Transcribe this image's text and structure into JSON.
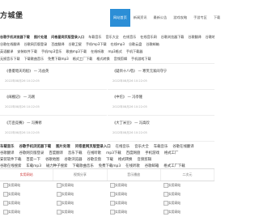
{
  "site": {
    "logo": "方城堡"
  },
  "nav": [
    "网站首页",
    "新闻资讯",
    "最新公告",
    "游戏攻略",
    "手游专区",
    "下载"
  ],
  "links_row1": [
    "谷歌手机浏览器下载",
    "图片处理",
    "问卷星网页版登录入口",
    "车载音乐",
    "音乐大全",
    "在线音乐",
    "在线音乐网",
    "谷歌浏览器下载",
    "谷歌翻译",
    "谷歌地图"
  ],
  "links_row2": [
    "谷歌在线翻译",
    "谷歌网页版登录",
    "百度翻译",
    "谷歌卫星",
    "手机mp3下载",
    "在线mp3",
    "谷歌云盘",
    "谷歌邮箱"
  ],
  "links_row3": [
    "英语翻译",
    "安装软件下载",
    "手机mp3音乐",
    "歌曲mp3下载",
    "在线听歌",
    "mp3格式",
    "手机下载器"
  ],
  "links_row4": [
    "无损音乐下载",
    "下载歌曲音乐",
    "免费下载mp3",
    "格式工厂下载",
    "格式转换",
    "音频剪辑",
    "手机游戏下载"
  ],
  "cards": [
    {
      "title": "《香菱暗天的程》 — 冯益英",
      "time": "2022年08月26 10:22:05"
    },
    {
      "title": "《疑目十八嗒》 — 寒笑元家间守宁",
      "time": "2022年08月26 10:22:05"
    },
    {
      "title": "《阔楓记》 — 冯刚",
      "time": "2022年08月26 10:22:05"
    },
    {
      "title": "《中佗》 — 冯亭隆",
      "time": "2022年08月26 10:22:05"
    },
    {
      "title": "《万亩竞赛》 — 冯赛修",
      "time": "2022年08月26 10:22:05"
    },
    {
      "title": "《大丁米豆》 — 冯高欣",
      "time": "2022年08月26 10:22:05"
    }
  ],
  "cat_row1": [
    "车载音乐",
    "谷歌手机浏览器下载",
    "图片处理",
    "问卷星网页版登录入口",
    "在线音乐",
    "音乐大全",
    "车载音乐",
    "谷歌在线翻译"
  ],
  "cat_row2": [
    "谷歌翻译",
    "谷歌网页版登录",
    "百度翻译",
    "音乐下载",
    "在线听歌",
    "mp3下载",
    "百度网盘",
    "手机游戏",
    "格式工厂"
  ],
  "cat_row3": [
    "安装软件下载",
    "百度一下",
    "谷歌地图",
    "谷歌浏览器",
    "谷歌云盘",
    "下载",
    "格式转换",
    "音频剪辑"
  ],
  "cat_row4": [
    "谷歌在线搜索",
    "车载mp3",
    "磁力种子搜索",
    "下载歌曲音乐",
    "免费下载mp3",
    "在线听歌",
    "谷歌邮箱",
    "格式工厂下载"
  ],
  "tabs": [
    "实用网站",
    "视频分享",
    "音乐播放",
    "二次元"
  ],
  "grid": [
    "实用网站",
    "实用网站",
    "实用网站",
    "实用网站",
    "实用网站",
    "实用网站",
    "实用网站",
    "实用网站",
    "实用网站",
    "实用网站",
    "实用网站",
    "实用网站",
    "实用网站",
    "实用网站",
    "实用网站",
    "实用网站"
  ]
}
